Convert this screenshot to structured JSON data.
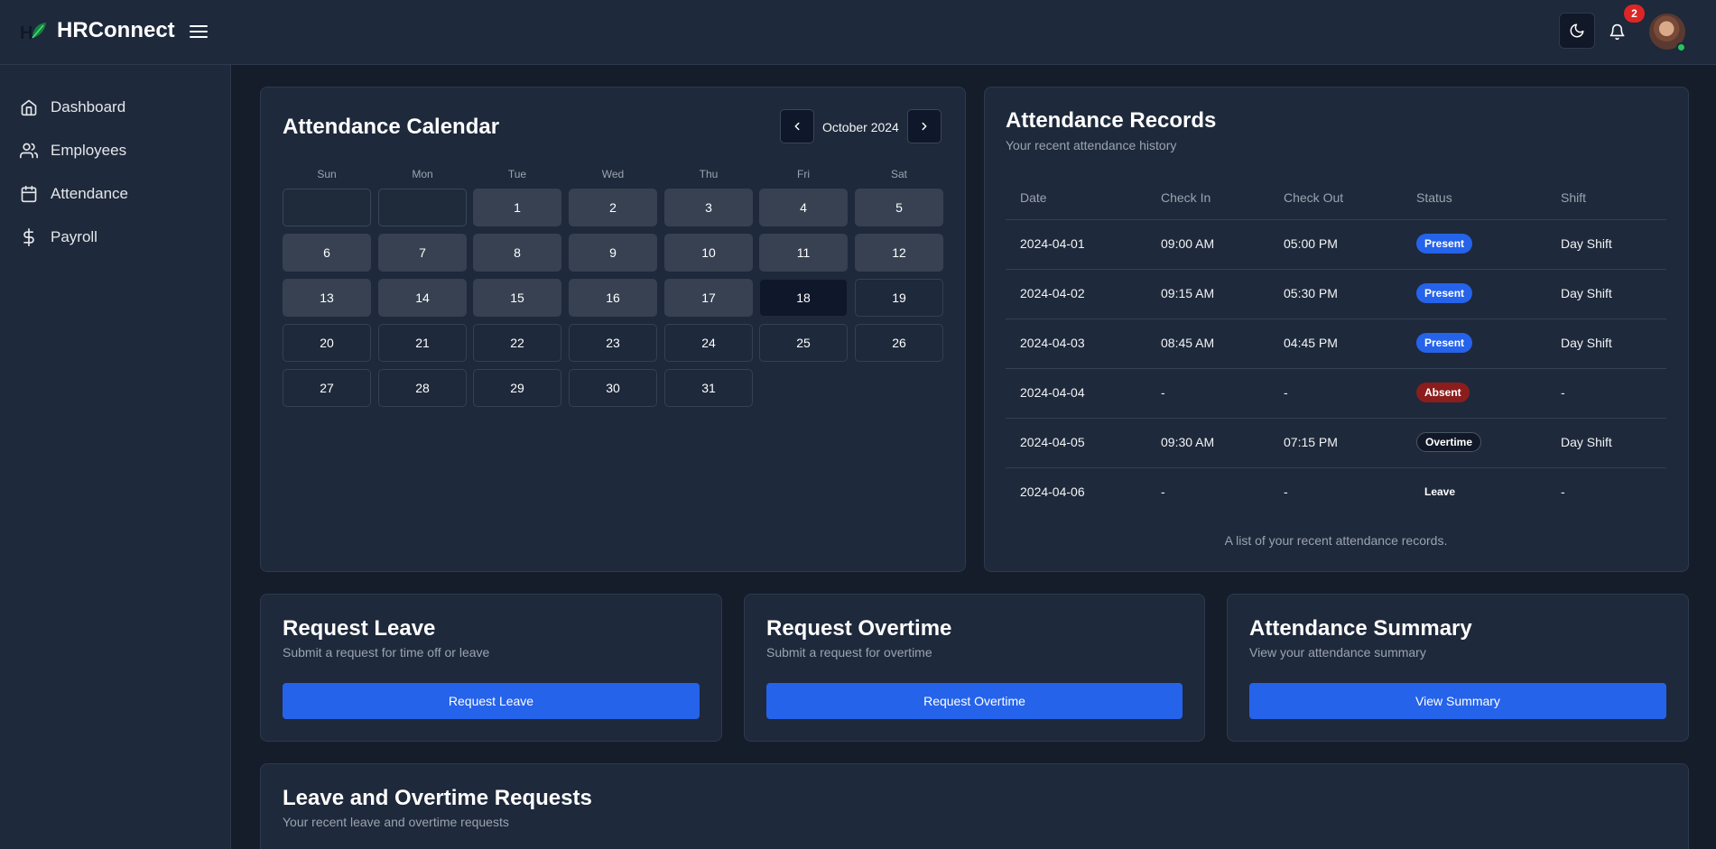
{
  "header": {
    "app_title": "HRConnect",
    "notification_count": "2"
  },
  "sidebar": {
    "items": [
      {
        "label": "Dashboard",
        "icon": "home-icon"
      },
      {
        "label": "Employees",
        "icon": "users-icon"
      },
      {
        "label": "Attendance",
        "icon": "calendar-icon"
      },
      {
        "label": "Payroll",
        "icon": "dollar-icon"
      }
    ]
  },
  "calendar": {
    "title": "Attendance Calendar",
    "month_label": "October 2024",
    "weekdays": [
      "Sun",
      "Mon",
      "Tue",
      "Wed",
      "Thu",
      "Fri",
      "Sat"
    ],
    "days": [
      "1",
      "2",
      "3",
      "4",
      "5",
      "6",
      "7",
      "8",
      "9",
      "10",
      "11",
      "12",
      "13",
      "14",
      "15",
      "16",
      "17",
      "18",
      "19",
      "20",
      "21",
      "22",
      "23",
      "24",
      "25",
      "26",
      "27",
      "28",
      "29",
      "30",
      "31"
    ],
    "today": "18"
  },
  "records": {
    "title": "Attendance Records",
    "subtitle": "Your recent attendance history",
    "columns": [
      "Date",
      "Check In",
      "Check Out",
      "Status",
      "Shift"
    ],
    "rows": [
      {
        "date": "2024-04-01",
        "check_in": "09:00 AM",
        "check_out": "05:00 PM",
        "status": "Present",
        "shift": "Day Shift"
      },
      {
        "date": "2024-04-02",
        "check_in": "09:15 AM",
        "check_out": "05:30 PM",
        "status": "Present",
        "shift": "Day Shift"
      },
      {
        "date": "2024-04-03",
        "check_in": "08:45 AM",
        "check_out": "04:45 PM",
        "status": "Present",
        "shift": "Day Shift"
      },
      {
        "date": "2024-04-04",
        "check_in": "-",
        "check_out": "-",
        "status": "Absent",
        "shift": "-"
      },
      {
        "date": "2024-04-05",
        "check_in": "09:30 AM",
        "check_out": "07:15 PM",
        "status": "Overtime",
        "shift": "Day Shift"
      },
      {
        "date": "2024-04-06",
        "check_in": "-",
        "check_out": "-",
        "status": "Leave",
        "shift": "-"
      }
    ],
    "caption": "A list of your recent attendance records."
  },
  "request_leave": {
    "title": "Request Leave",
    "subtitle": "Submit a request for time off or leave",
    "button": "Request Leave"
  },
  "request_overtime": {
    "title": "Request Overtime",
    "subtitle": "Submit a request for overtime",
    "button": "Request Overtime"
  },
  "summary": {
    "title": "Attendance Summary",
    "subtitle": "View your attendance summary",
    "button": "View Summary"
  },
  "requests": {
    "title": "Leave and Overtime Requests",
    "subtitle": "Your recent leave and overtime requests"
  },
  "colors": {
    "accent": "#2563eb",
    "absent": "#8b1d1d",
    "notification": "#dc2626",
    "online": "#22c55e"
  }
}
